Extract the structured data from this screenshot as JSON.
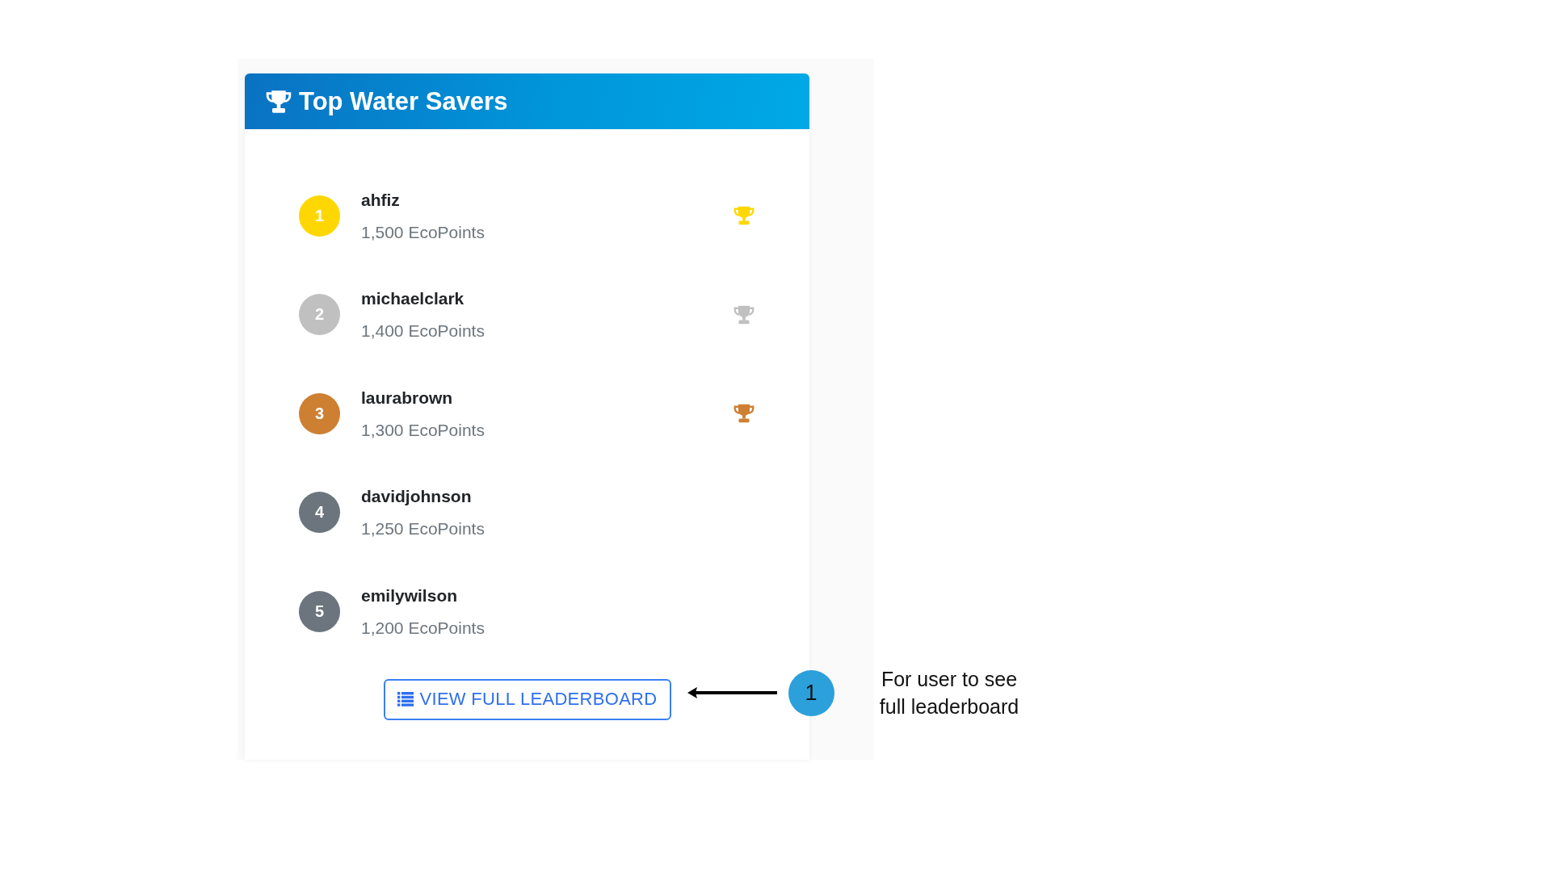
{
  "leaderboard": {
    "title": "Top Water Savers",
    "entries": [
      {
        "rank": "1",
        "name": "ahfiz",
        "points": "1,500 EcoPoints",
        "color": "#ffd700",
        "trophy": true
      },
      {
        "rank": "2",
        "name": "michaelclark",
        "points": "1,400 EcoPoints",
        "color": "#c0c0c0",
        "trophy": true
      },
      {
        "rank": "3",
        "name": "laurabrown",
        "points": "1,300 EcoPoints",
        "color": "#cd7f32",
        "trophy": true
      },
      {
        "rank": "4",
        "name": "davidjohnson",
        "points": "1,250 EcoPoints",
        "color": "#6c757d",
        "trophy": false
      },
      {
        "rank": "5",
        "name": "emilywilson",
        "points": "1,200 EcoPoints",
        "color": "#6c757d",
        "trophy": false
      }
    ],
    "button": {
      "label": "VIEW FULL LEADERBOARD"
    }
  },
  "annotation": {
    "number": "1",
    "text": "For user to see full leaderboard"
  }
}
